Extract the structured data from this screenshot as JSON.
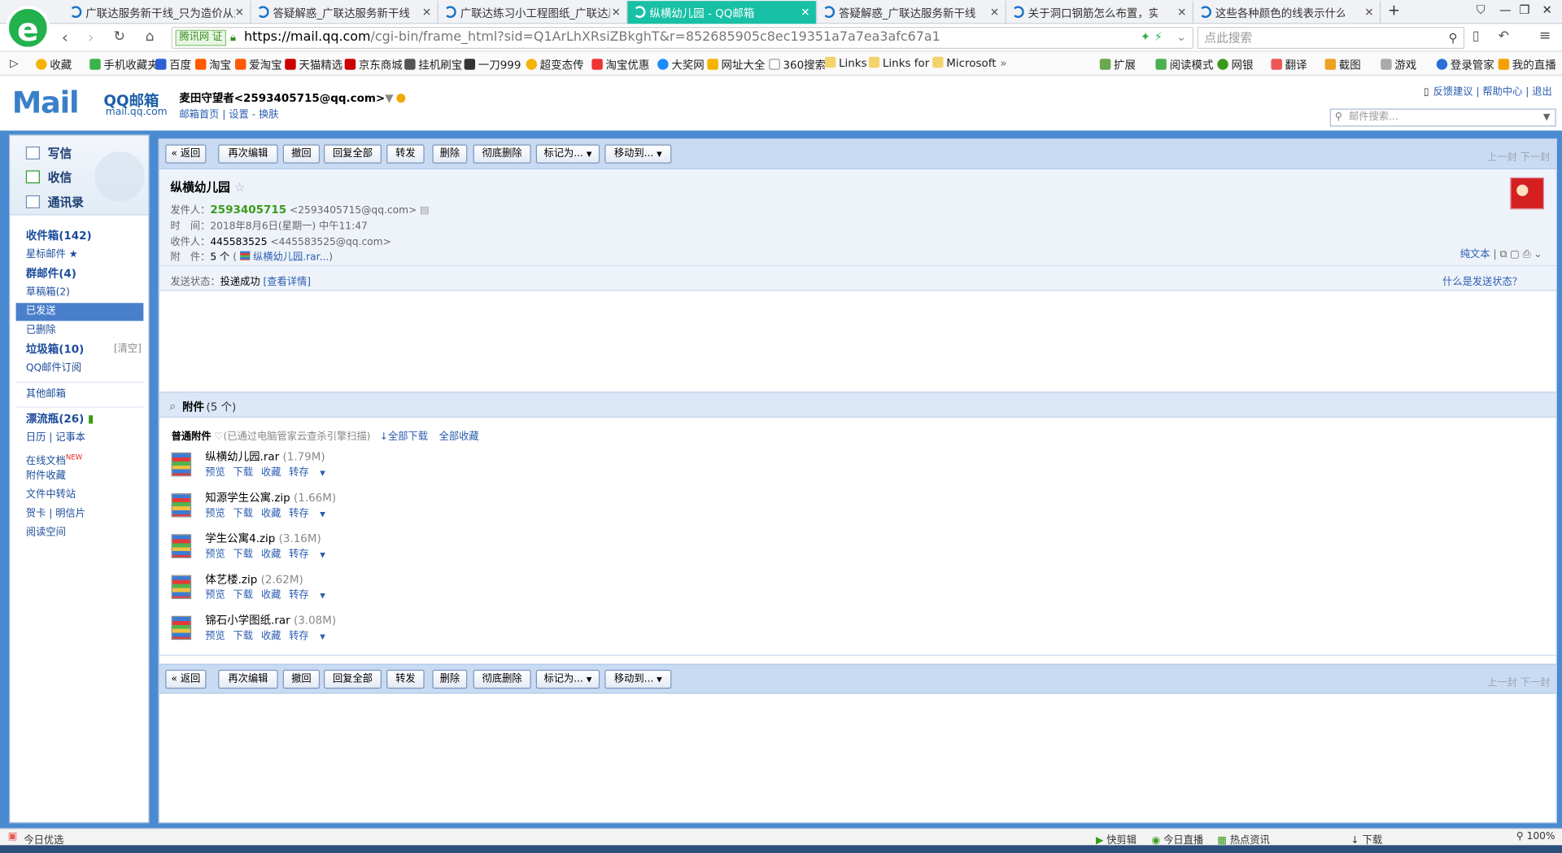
{
  "browser": {
    "tabs": [
      {
        "title": "广联达服务新干线_只为造价从业"
      },
      {
        "title": "答疑解惑_广联达服务新干线"
      },
      {
        "title": "广联达练习小工程图纸_广联达服"
      },
      {
        "title": "纵横幼儿园 - QQ邮箱",
        "active": true
      },
      {
        "title": "答疑解惑_广联达服务新干线"
      },
      {
        "title": "关于洞口钢筋怎么布置，实在不"
      },
      {
        "title": "这些各种颜色的线表示什么意思"
      }
    ],
    "cert_label": "腾讯网",
    "url_host": "https://mail.qq.com",
    "url_path": "/cgi-bin/frame_html?sid=Q1ArLhXRsiZBkghT&r=852685905c8ec19351a7a7ea3afc67a1",
    "search_placeholder": "点此搜索",
    "bookmarks": [
      "收藏",
      "手机收藏夹",
      "百度",
      "淘宝",
      "爱淘宝",
      "天猫精选",
      "京东商城",
      "挂机刷宝",
      "一刀999",
      "超变态传",
      "淘宝优惠",
      "大奖网",
      "网址大全",
      "360搜索",
      "Links",
      "Links for",
      "Microsoft"
    ],
    "right_tools": [
      "扩展",
      "阅读模式",
      "网银",
      "翻译",
      "截图",
      "游戏",
      "登录管家",
      "我的直播"
    ],
    "status_left": "今日优选",
    "status_right": [
      "快剪辑",
      "今日直播",
      "热点资讯",
      "下载",
      "100%"
    ]
  },
  "mail_header": {
    "logo_brand": "QQ邮箱",
    "logo_domain": "mail.qq.com",
    "logo_word": "Mail",
    "user": "麦田守望者<2593405715@qq.com>",
    "links": "邮箱首页 | 设置 - 换肤",
    "top_links": "反馈建议 | 帮助中心 | 退出",
    "search_placeholder": "邮件搜索..."
  },
  "sidebar": {
    "compose": "写信",
    "inbox_btn": "收信",
    "contacts": "通讯录",
    "folders": [
      {
        "label": "收件箱(142)",
        "bold": true
      },
      {
        "label": "星标邮件 ★"
      },
      {
        "label": "群邮件(4)",
        "bold": true
      },
      {
        "label": "草稿箱(2)"
      },
      {
        "label": "已发送",
        "selected": true
      },
      {
        "label": "已删除"
      },
      {
        "label": "垃圾箱(10)",
        "bold": true,
        "extra": "[清空]"
      },
      {
        "label": "QQ邮件订阅"
      },
      {
        "label": "其他邮箱"
      },
      {
        "label": "漂流瓶(26)",
        "bold": true
      },
      {
        "label": "日历 | 记事本"
      },
      {
        "label": "在线文档",
        "badge": "NEW"
      },
      {
        "label": "附件收藏"
      },
      {
        "label": "文件中转站"
      },
      {
        "label": "贺卡 | 明信片"
      },
      {
        "label": "阅读空间"
      }
    ]
  },
  "toolbar": {
    "back": "« 返回",
    "reedit": "再次编辑",
    "recall": "撤回",
    "reply_all": "回复全部",
    "forward": "转发",
    "delete": "删除",
    "delete_perm": "彻底删除",
    "mark_as": "标记为...",
    "move_to": "移动到...",
    "prev_next": "上一封 下一封"
  },
  "mail": {
    "subject": "纵横幼儿园",
    "from_label": "发件人：",
    "from_name": "2593405715",
    "from_addr": "<2593405715@qq.com>",
    "time_label": "时　间：",
    "time": "2018年8月6日(星期一) 中午11:47",
    "to_label": "收件人：",
    "to_name": "445583525",
    "to_addr": "<445583525@qq.com>",
    "att_label": "附　件：",
    "att_count": "5 个",
    "att_first": "纵横幼儿园.rar...",
    "plain_text": "纯文本",
    "send_status_label": "发送状态：",
    "send_status": "投递成功",
    "view_detail": "[查看详情]",
    "what_status": "什么是发送状态？"
  },
  "attachments": {
    "header": "附件",
    "header_count": "(5 个)",
    "type_label": "普通附件",
    "scan_note": "(已通过电脑管家云查杀引擎扫描)",
    "download_all": "全部下载",
    "collect_all": "全部收藏",
    "ops": [
      "预览",
      "下载",
      "收藏",
      "转存"
    ],
    "files": [
      {
        "name": "纵横幼儿园.rar",
        "size": "(1.79M)"
      },
      {
        "name": "知源学生公寓.zip",
        "size": "(1.66M)"
      },
      {
        "name": "学生公寓4.zip",
        "size": "(3.16M)"
      },
      {
        "name": "体艺楼.zip",
        "size": "(2.62M)"
      },
      {
        "name": "锦石小学图纸.rar",
        "size": "(3.08M)"
      }
    ]
  }
}
